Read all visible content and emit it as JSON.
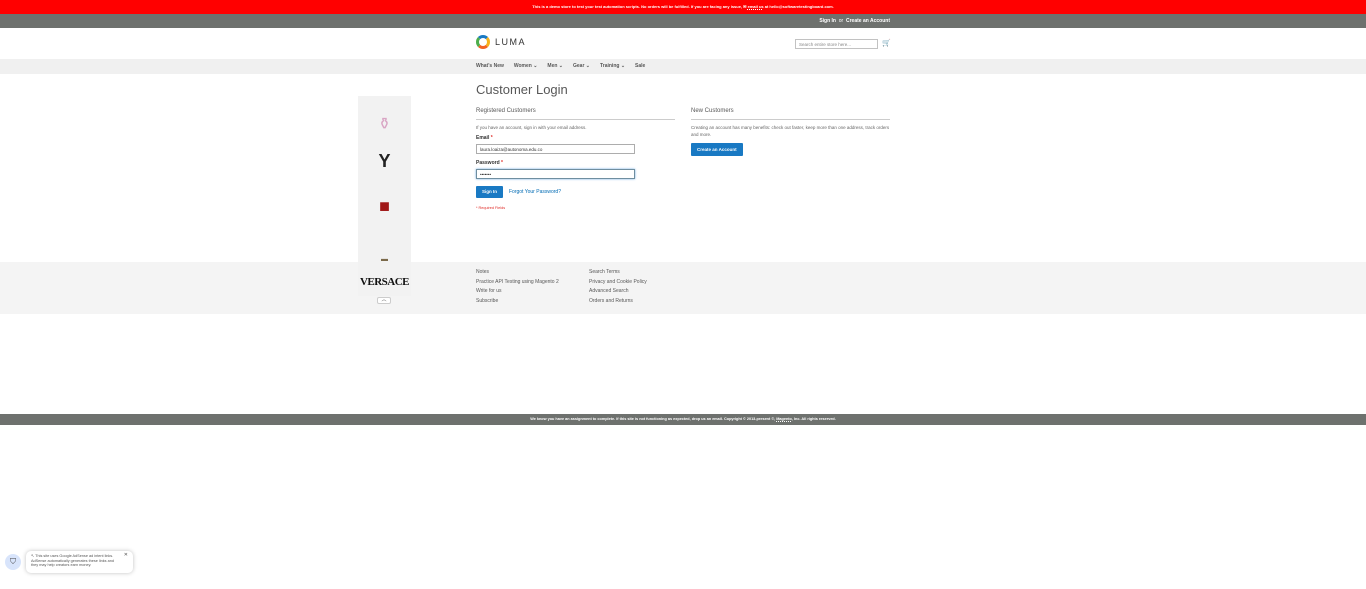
{
  "notice": {
    "text": "This is a demo store to test your test automation scripts. No orders will be fulfilled. If you are facing any issue, ✉ ",
    "link": "email us",
    "suffix": " at hello@softwaretestingboard.com."
  },
  "topbar": {
    "sign_in": "Sign In",
    "or": "or",
    "create": "Create an Account"
  },
  "header": {
    "logo": "LUMA",
    "search_placeholder": "Search entire store here...",
    "cart_icon": "cart-icon"
  },
  "nav": [
    "What's New",
    "Women ⌄",
    "Men ⌄",
    "Gear ⌄",
    "Training ⌄",
    "Sale"
  ],
  "page": {
    "title": "Customer Login"
  },
  "registered": {
    "heading": "Registered Customers",
    "intro": "If you have an account, sign in with your email address.",
    "email_label": "Email",
    "email_value": "laura.loaiza@autonoma.edu.co",
    "password_label": "Password",
    "password_value": "•••••••",
    "sign_in": "Sign In",
    "forgot": "Forgot Your Password?",
    "required": "* Required Fields"
  },
  "new_customers": {
    "heading": "New Customers",
    "text": "Creating an account has many benefits: check out faster, keep more than one address, track orders and more.",
    "button": "Create an Account"
  },
  "footer": {
    "col1": [
      "Notes",
      "Practice API Testing using Magento 2",
      "Write for us",
      "Subscribe"
    ],
    "col2": [
      "Search Terms",
      "Privacy and Cookie Policy",
      "Advanced Search",
      "Orders and Returns"
    ]
  },
  "bottom": {
    "text": "We know you have an assignment to complete. If this site is not functioning as expected, drop us an email. Copyright © 2013-present ©, ",
    "link": "Magento",
    "suffix": ", Inc. All rights reserved."
  },
  "ad": {
    "brand": "VERSACE",
    "toggle": "︿"
  },
  "adsense": {
    "text": "↖ This site uses Google AdSense ad intent links. AdSense automatically generates these links and they may help creators earn money.",
    "close": "✕"
  }
}
